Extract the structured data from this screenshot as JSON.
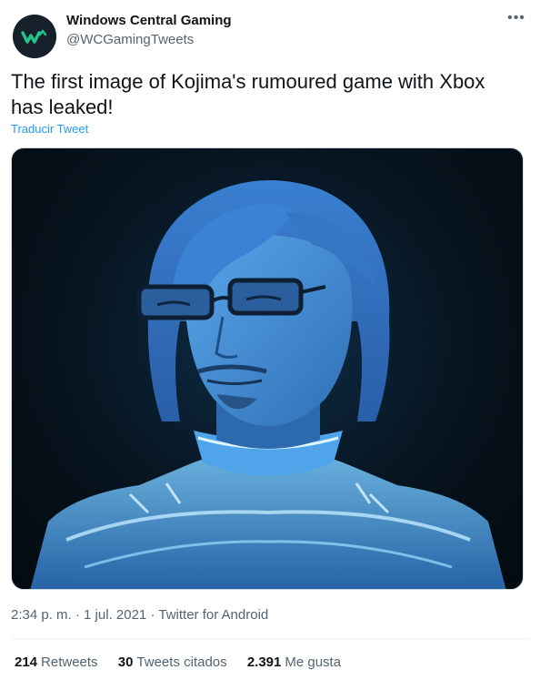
{
  "author": {
    "name": "Windows Central Gaming",
    "handle": "@WCGamingTweets"
  },
  "tweet": {
    "text": "The first image of Kojima's rumoured game with Xbox has leaked!",
    "translate_label": "Traducir Tweet"
  },
  "meta": {
    "time": "2:34 p. m.",
    "separator": "·",
    "date": "1 jul. 2021",
    "source": "Twitter for Android"
  },
  "stats": {
    "retweets_count": "214",
    "retweets_label": "Retweets",
    "quotes_count": "30",
    "quotes_label": "Tweets citados",
    "likes_count": "2.391",
    "likes_label": "Me gusta"
  },
  "colors": {
    "link": "#1d9bf0",
    "secondary_text": "#536471",
    "hologram_blue": "#4a9ee8"
  },
  "icons": {
    "more": "more-horizontal-icon",
    "avatar_logo": "windows-central-logo-icon"
  }
}
